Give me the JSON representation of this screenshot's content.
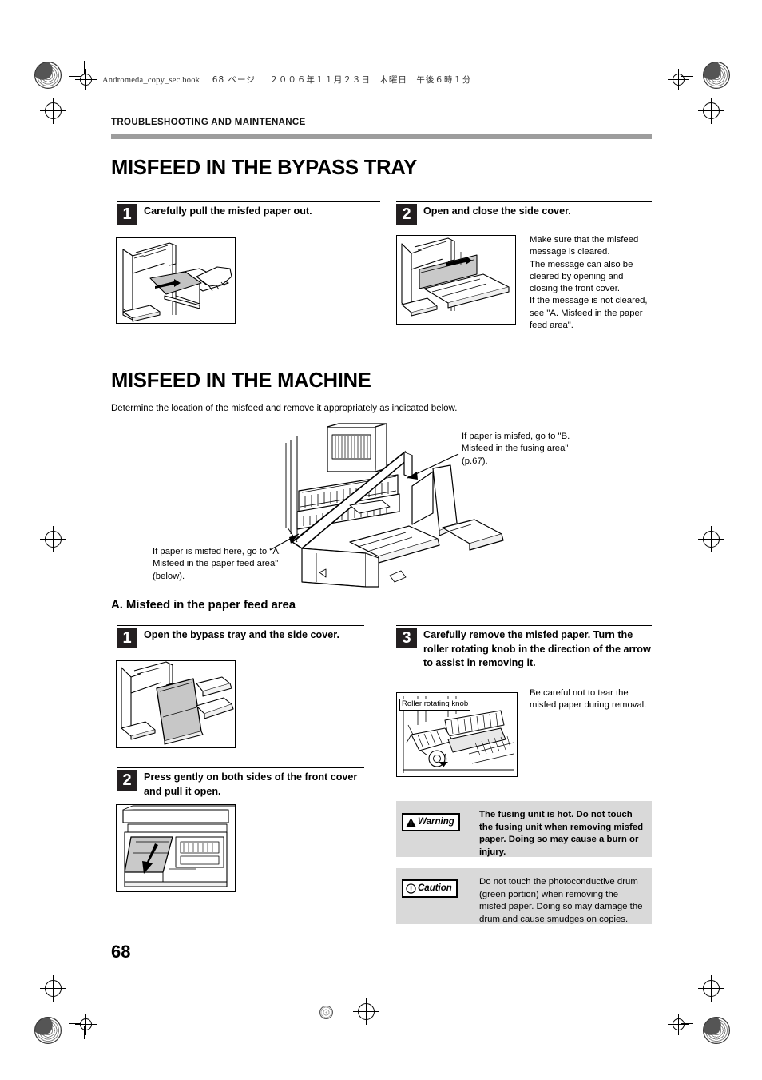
{
  "page": {
    "book_line_file": "Andromeda_copy_sec.book",
    "book_line_page": "68 ページ",
    "book_line_date": "２００６年１１月２３日　木曜日　午後６時１分",
    "running_head": "TROUBLESHOOTING AND MAINTENANCE",
    "folio": "68",
    "rule_color": "#9d9d9d",
    "panel_bg": "#d9d9d9",
    "number_box_color": "#231f20"
  },
  "bypass_section": {
    "title": "MISFEED IN THE BYPASS TRAY",
    "steps": [
      {
        "number": "1",
        "text": "Carefully pull the misfed paper out.",
        "illustration_name": "bypass-tray-pull-paper-illustration"
      },
      {
        "number": "2",
        "text": "Open and close the side cover.",
        "illustration_name": "side-cover-open-close-illustration",
        "note": "Make sure that the misfeed message is cleared.\nThe message can also be cleared by opening and closing the front cover.\nIf the message is not cleared, see \"A. Misfeed in the paper feed area\"."
      }
    ]
  },
  "machine_section": {
    "title": "MISFEED IN THE MACHINE",
    "intro": "Determine the location  of the misfeed and remove it appropriately as indicated below.",
    "diagram_name": "machine-misfeed-location-diagram",
    "callout_fusing": "If paper is misfed, go to \"B. Misfeed in the fusing area\" (p.67).",
    "callout_feed": "If paper is misfed here, go to \"A. Misfeed in the paper feed area\" (below)."
  },
  "feed_area_section": {
    "title": "A. Misfeed in the paper feed area",
    "steps": [
      {
        "number": "1",
        "text": "Open the bypass tray and the side cover.",
        "illustration_name": "open-bypass-tray-side-cover-illustration"
      },
      {
        "number": "2",
        "text": "Press gently on both sides of the front cover and pull it open.",
        "illustration_name": "front-cover-open-illustration"
      },
      {
        "number": "3",
        "text": "Carefully remove the misfed paper. Turn the roller rotating knob in the direction of the arrow to assist in removing it.",
        "illustration_name": "remove-misfed-paper-illustration",
        "note": "Be careful not to tear the misfed paper during removal.",
        "illustration_label": "Roller rotating knob"
      }
    ],
    "warning": {
      "label": "Warning",
      "text": "The fusing unit is hot. Do not touch the fusing unit when removing misfed paper. Doing so may cause a burn or injury."
    },
    "caution": {
      "label": "Caution",
      "text": "Do not touch the photoconductive drum (green portion) when removing the misfed paper. Doing so may damage the drum and cause smudges on copies."
    }
  }
}
